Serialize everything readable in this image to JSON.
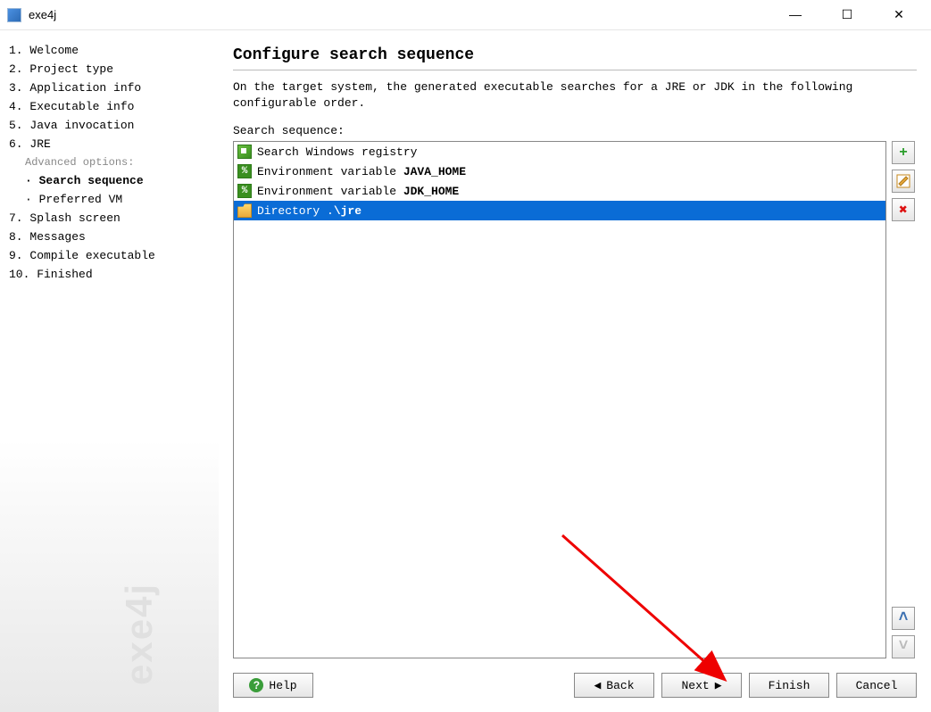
{
  "window": {
    "title": "exe4j",
    "watermark": "exe4j"
  },
  "nav": {
    "items": [
      {
        "num": "1.",
        "label": "Welcome"
      },
      {
        "num": "2.",
        "label": "Project type"
      },
      {
        "num": "3.",
        "label": "Application info"
      },
      {
        "num": "4.",
        "label": "Executable info"
      },
      {
        "num": "5.",
        "label": "Java invocation"
      },
      {
        "num": "6.",
        "label": "JRE"
      }
    ],
    "advanced_label": "Advanced options:",
    "adv_items": [
      {
        "bullet": "·",
        "label": "Search sequence",
        "bold": true
      },
      {
        "bullet": "·",
        "label": "Preferred VM",
        "bold": false
      }
    ],
    "items2": [
      {
        "num": "7.",
        "label": "Splash screen"
      },
      {
        "num": "8.",
        "label": "Messages"
      },
      {
        "num": "9.",
        "label": "Compile executable"
      },
      {
        "num": "10.",
        "label": "Finished"
      }
    ]
  },
  "main": {
    "title": "Configure search sequence",
    "desc": "On the target system, the generated executable searches for a JRE or JDK in the following configurable order.",
    "seq_label": "Search sequence:",
    "items": [
      {
        "icon": "registry",
        "text": "Search Windows registry",
        "bold": ""
      },
      {
        "icon": "env",
        "text": "Environment variable ",
        "bold": "JAVA_HOME"
      },
      {
        "icon": "env",
        "text": "Environment variable ",
        "bold": "JDK_HOME"
      },
      {
        "icon": "folder",
        "text": "Directory .",
        "bold": "\\jre",
        "selected": true
      }
    ]
  },
  "footer": {
    "help": "Help",
    "back": "Back",
    "next": "Next",
    "finish": "Finish",
    "cancel": "Cancel"
  }
}
